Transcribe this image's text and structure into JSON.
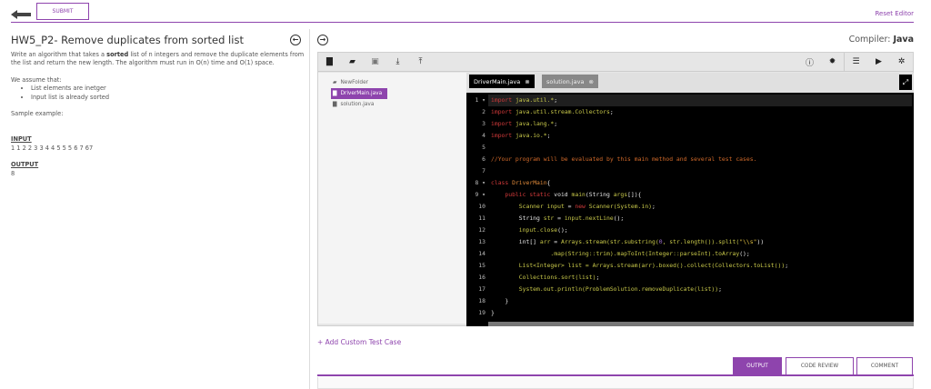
{
  "header": {
    "submit_label": "SUBMIT",
    "reset_label": "Reset Editor"
  },
  "problem": {
    "title": "HW5_P2- Remove duplicates from sorted list",
    "desc_before": "Write an algorithm that takes a ",
    "desc_bold": "sorted",
    "desc_after": " list of n integers and remove the duplicate elements from the list and return the new length. The algorithm must run in O(n) time and O(1) space.",
    "assume": "We assume that:",
    "bullets": [
      "List elements are inetger",
      "Input list is already sorted"
    ],
    "sample": "Sample example:",
    "input_label": "INPUT",
    "input_value": "1 1 2 2 3 3 4 4 5 5 5 6 7 67",
    "output_label": "OUTPUT",
    "output_value": "8"
  },
  "compiler": {
    "label": "Compiler:",
    "value": "Java"
  },
  "tree": {
    "items": [
      "NewFolder",
      "DriverMain.java",
      "solution.java"
    ]
  },
  "tabs": [
    "DriverMain.java",
    "solution.java"
  ],
  "code": [
    [
      [
        "kw",
        "import"
      ],
      [
        "t",
        " "
      ],
      [
        "id",
        "java.util.*"
      ],
      [
        "t",
        ";"
      ]
    ],
    [
      [
        "kw",
        "import"
      ],
      [
        "t",
        " "
      ],
      [
        "id",
        "java.util.stream.Collectors"
      ],
      [
        "t",
        ";"
      ]
    ],
    [
      [
        "kw",
        "import"
      ],
      [
        "t",
        " "
      ],
      [
        "id",
        "java.lang.*"
      ],
      [
        "t",
        ";"
      ]
    ],
    [
      [
        "kw",
        "import"
      ],
      [
        "t",
        " "
      ],
      [
        "id",
        "java.io.*"
      ],
      [
        "t",
        ";"
      ]
    ],
    [],
    [
      [
        "cm",
        "//Your program will be evaluated by this main method and several test cases."
      ]
    ],
    [],
    [
      [
        "kw",
        "class"
      ],
      [
        "t",
        " "
      ],
      [
        "cls",
        "DriverMain"
      ],
      [
        "t",
        "{"
      ]
    ],
    [
      [
        "t",
        "    "
      ],
      [
        "kw",
        "public static"
      ],
      [
        "t",
        " void "
      ],
      [
        "id",
        "main"
      ],
      [
        "t",
        "(String "
      ],
      [
        "id",
        "args"
      ],
      [
        "t",
        "[]){"
      ]
    ],
    [
      [
        "t",
        "        "
      ],
      [
        "id",
        "Scanner input"
      ],
      [
        "t",
        " = "
      ],
      [
        "kw",
        "new"
      ],
      [
        "t",
        " "
      ],
      [
        "id",
        "Scanner(System.in)"
      ],
      [
        "t",
        ";"
      ]
    ],
    [
      [
        "t",
        "        String "
      ],
      [
        "id",
        "str"
      ],
      [
        "t",
        " = "
      ],
      [
        "id",
        "input.nextLine"
      ],
      [
        "t",
        "();"
      ]
    ],
    [
      [
        "t",
        "        "
      ],
      [
        "id",
        "input.close"
      ],
      [
        "t",
        "();"
      ]
    ],
    [
      [
        "t",
        "        int[] "
      ],
      [
        "id",
        "arr"
      ],
      [
        "t",
        " = "
      ],
      [
        "id",
        "Arrays.stream(str.substring("
      ],
      [
        "nm",
        "0"
      ],
      [
        "id",
        ", str.length()).split("
      ],
      [
        "st",
        "\"\\\\s\""
      ],
      [
        "t",
        "))"
      ]
    ],
    [
      [
        "t",
        "                 "
      ],
      [
        "id",
        ".map(String::trim).mapToInt(Integer::parseInt).toArray"
      ],
      [
        "t",
        "();"
      ]
    ],
    [
      [
        "t",
        "        "
      ],
      [
        "id",
        "List<Integer> list = Arrays.stream(arr).boxed().collect(Collectors.toList())"
      ],
      [
        "t",
        ";"
      ]
    ],
    [
      [
        "t",
        "        "
      ],
      [
        "id",
        "Collections.sort(list)"
      ],
      [
        "t",
        ";"
      ]
    ],
    [
      [
        "t",
        "        "
      ],
      [
        "id",
        "System.out.println(ProblemSolution.removeDuplicate(list))"
      ],
      [
        "t",
        ";"
      ]
    ],
    [
      [
        "t",
        "    }"
      ]
    ],
    [
      [
        "t",
        "}"
      ]
    ]
  ],
  "add_test_case": "+ Add Custom Test Case",
  "bottom_tabs": [
    "OUTPUT",
    "CODE REVIEW",
    "COMMENT"
  ]
}
